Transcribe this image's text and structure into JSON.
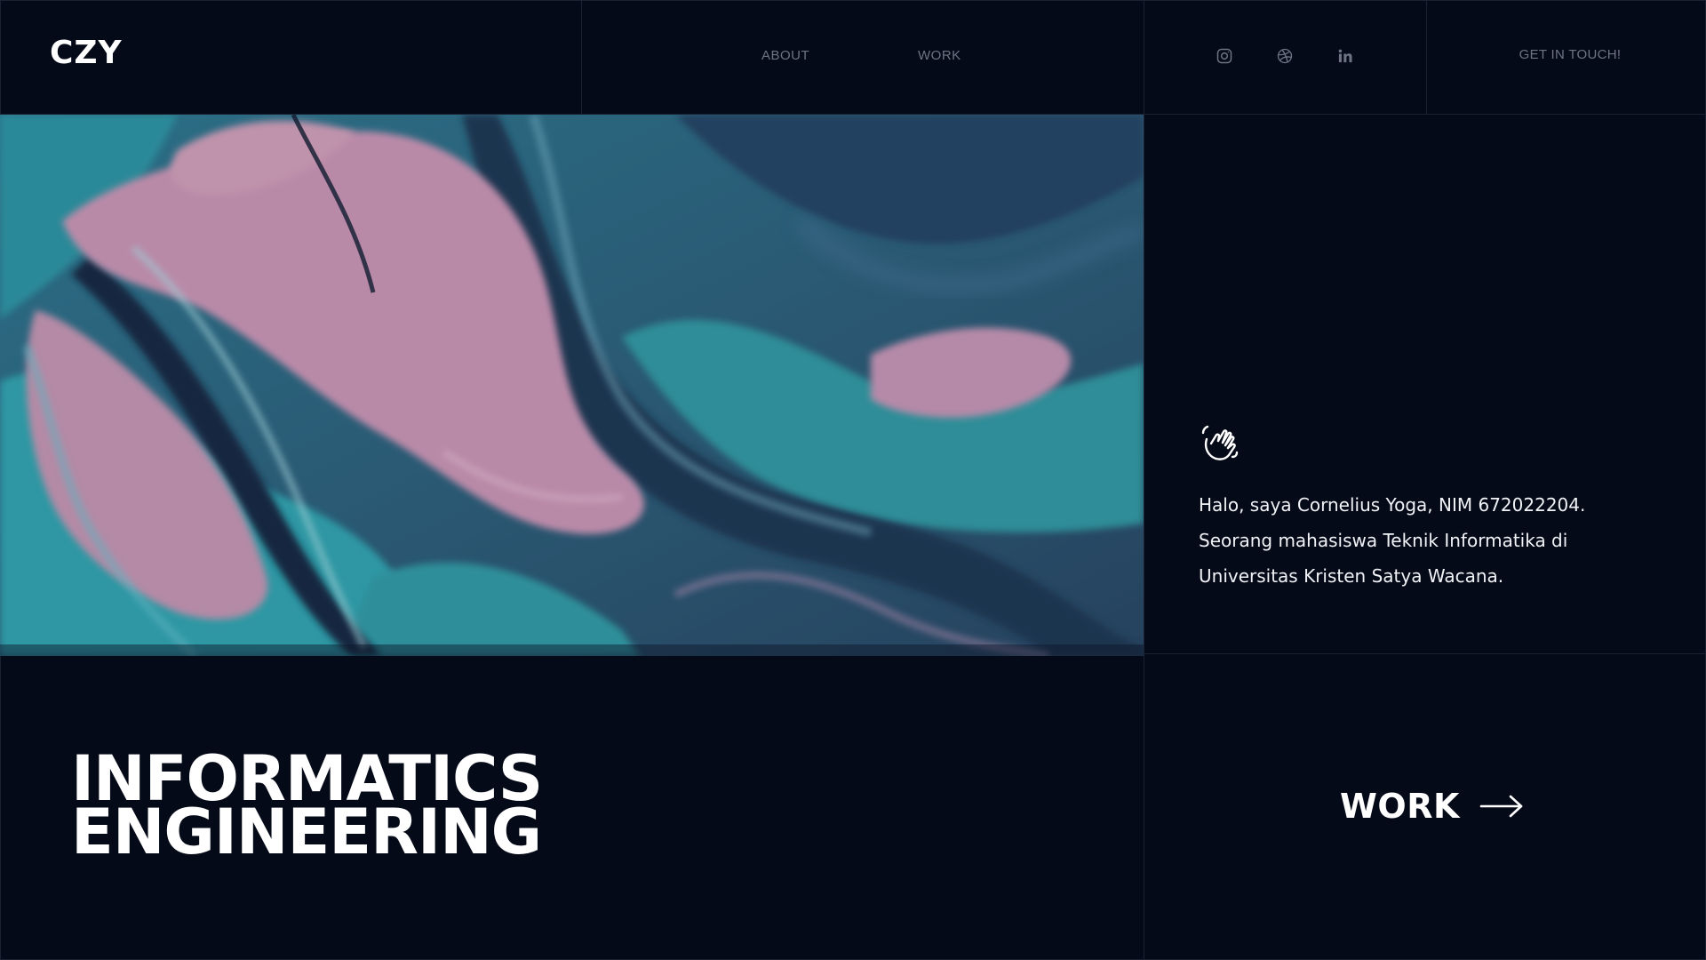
{
  "header": {
    "logo": "CZY",
    "nav": [
      {
        "label": "ABOUT"
      },
      {
        "label": "WORK"
      }
    ],
    "social": [
      {
        "icon": "instagram-icon"
      },
      {
        "icon": "dribbble-icon"
      },
      {
        "icon": "linkedin-icon"
      }
    ],
    "cta": "GET IN TOUCH!"
  },
  "intro": {
    "icon": "waving-hand-icon",
    "lines": [
      "Halo, saya Cornelius Yoga, NIM 672022204.",
      "Seorang mahasiswa Teknik Informatika di",
      "Universitas Kristen Satya Wacana."
    ]
  },
  "headline": {
    "line1": "INFORMATICS",
    "line2": "ENGINEERING"
  },
  "work_link": {
    "label": "WORK",
    "icon": "arrow-right-icon"
  },
  "colors": {
    "background": "#050a18",
    "grid_line": "#1a2132",
    "nav_text": "#6e7484",
    "text": "#ffffff",
    "paint_pink": "#b88aa6",
    "paint_teal": "#2f8f9a",
    "paint_navy": "#1e3550"
  }
}
